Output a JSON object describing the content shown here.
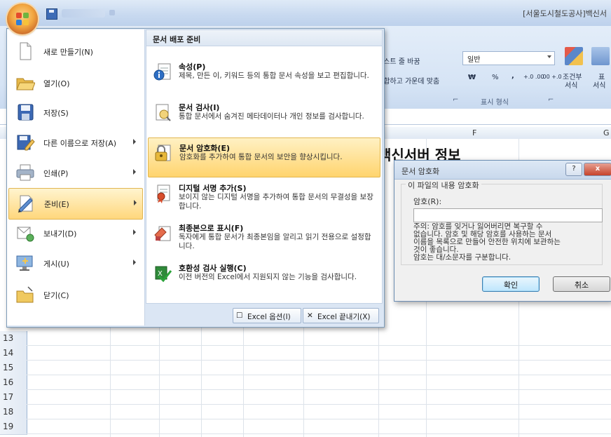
{
  "window": {
    "title": "[서울도시철도공사]백신서"
  },
  "ribbon": {
    "wrap_text": "텍스트 줄 바꿈",
    "merge_center": "병합하고 가운데 맞춤",
    "number_format_value": "일반",
    "number_group_label": "표시 형식",
    "currency_symbol": "₩",
    "percent_symbol": "%",
    "comma_symbol": ",",
    "inc_decimal": "+.0 .00",
    "dec_decimal": ".00 +.0",
    "conditional_label_1": "조건부",
    "conditional_label_2": "서식",
    "table_label_1": "표",
    "table_label_2": "서식"
  },
  "sheet": {
    "columns": [
      "F",
      "G"
    ],
    "title_fragment": "백신서버 정보",
    "row_numbers": [
      "13",
      "14",
      "15",
      "16",
      "17",
      "18",
      "19"
    ]
  },
  "office_menu": {
    "left_items": [
      {
        "label": "새로 만들기(N)",
        "has_arrow": false
      },
      {
        "label": "열기(O)",
        "has_arrow": false
      },
      {
        "label": "저장(S)",
        "has_arrow": false
      },
      {
        "label": "다른 이름으로 저장(A)",
        "has_arrow": true
      },
      {
        "label": "인쇄(P)",
        "has_arrow": true
      },
      {
        "label": "준비(E)",
        "has_arrow": true,
        "selected": true
      },
      {
        "label": "보내기(D)",
        "has_arrow": true
      },
      {
        "label": "게시(U)",
        "has_arrow": true
      },
      {
        "label": "닫기(C)",
        "has_arrow": false
      }
    ],
    "right_header": "문서 배포 준비",
    "right_items": [
      {
        "title": "속성(P)",
        "desc": "제목, 만든 이, 키워드 등의 통합 문서 속성을 보고 편집합니다."
      },
      {
        "title": "문서 검사(I)",
        "desc": "통합 문서에서 숨겨진 메타데이터나 개인 정보를 검사합니다."
      },
      {
        "title": "문서 암호화(E)",
        "desc": "암호화를 추가하여 통합 문서의 보안을 향상시킵니다.",
        "selected": true
      },
      {
        "title": "디지털 서명 추가(S)",
        "desc": "보이지 않는 디지털 서명을 추가하여 통합 문서의 무결성을 보장합니다."
      },
      {
        "title": "최종본으로 표시(F)",
        "desc": "독자에게 통합 문서가 최종본임을 알리고 읽기 전용으로 설정합니다."
      },
      {
        "title": "호환성 검사 실행(C)",
        "desc": "이전 버전의 Excel에서 지원되지 않는 기능을 검사합니다."
      }
    ],
    "footer": {
      "options_label": "Excel 옵션(I)",
      "exit_label": "Excel 끝내기(X)"
    }
  },
  "dialog": {
    "title": "문서 암호화",
    "help_glyph": "?",
    "close_glyph": "x",
    "group_label": "이 파일의 내용 암호화",
    "password_label": "암호(R):",
    "password_value": "",
    "note_lines": [
      "주의: 암호를 잊거나 잃어버리면 복구할 수",
      "없습니다. 암호 및 해당 암호를 사용하는 문서",
      "이름을 목록으로 만들어 안전한 위치에 보관하는",
      "것이 좋습니다.",
      "암호는 대/소문자를 구분합니다."
    ],
    "ok_label": "확인",
    "cancel_label": "취소"
  },
  "colors": {
    "menu_highlight": "#ffd77c",
    "ribbon_bg": "#d6e4f5",
    "office_orange": "#f2a640"
  }
}
